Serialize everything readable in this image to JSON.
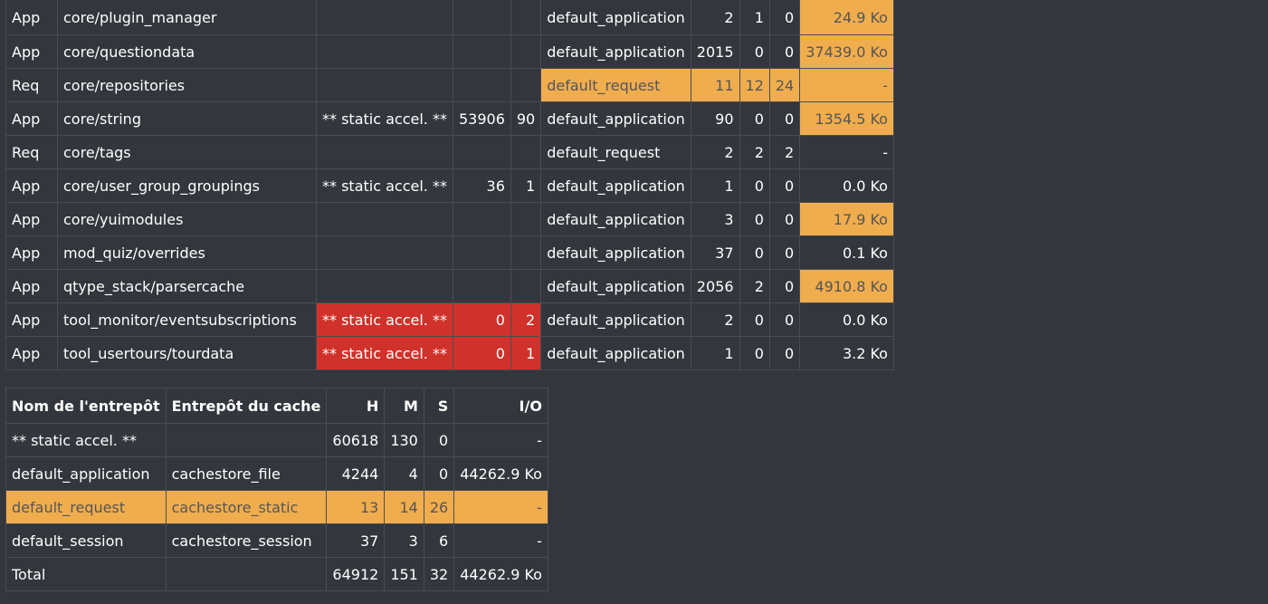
{
  "colors": {
    "background": "#33363c",
    "warning": "#f0ad4e",
    "danger": "#d0312a"
  },
  "definitions_table": {
    "rows": [
      {
        "mode": "App",
        "definition": "core/plugin_manager",
        "static": "",
        "sh": "",
        "sm": "",
        "store": "default_application",
        "h": "2",
        "m": "1",
        "s": "0",
        "io": "24.9 Ko",
        "static_red": false,
        "store_orange": false,
        "io_orange": true
      },
      {
        "mode": "App",
        "definition": "core/questiondata",
        "static": "",
        "sh": "",
        "sm": "",
        "store": "default_application",
        "h": "2015",
        "m": "0",
        "s": "0",
        "io": "37439.0 Ko",
        "static_red": false,
        "store_orange": false,
        "io_orange": true
      },
      {
        "mode": "Req",
        "definition": "core/repositories",
        "static": "",
        "sh": "",
        "sm": "",
        "store": "default_request",
        "h": "11",
        "m": "12",
        "s": "24",
        "io": "-",
        "static_red": false,
        "store_orange": true,
        "io_orange": true
      },
      {
        "mode": "App",
        "definition": "core/string",
        "static": "** static accel. **",
        "sh": "53906",
        "sm": "90",
        "store": "default_application",
        "h": "90",
        "m": "0",
        "s": "0",
        "io": "1354.5 Ko",
        "static_red": false,
        "store_orange": false,
        "io_orange": true
      },
      {
        "mode": "Req",
        "definition": "core/tags",
        "static": "",
        "sh": "",
        "sm": "",
        "store": "default_request",
        "h": "2",
        "m": "2",
        "s": "2",
        "io": "-",
        "static_red": false,
        "store_orange": false,
        "io_orange": false
      },
      {
        "mode": "App",
        "definition": "core/user_group_groupings",
        "static": "** static accel. **",
        "sh": "36",
        "sm": "1",
        "store": "default_application",
        "h": "1",
        "m": "0",
        "s": "0",
        "io": "0.0 Ko",
        "static_red": false,
        "store_orange": false,
        "io_orange": false
      },
      {
        "mode": "App",
        "definition": "core/yuimodules",
        "static": "",
        "sh": "",
        "sm": "",
        "store": "default_application",
        "h": "3",
        "m": "0",
        "s": "0",
        "io": "17.9 Ko",
        "static_red": false,
        "store_orange": false,
        "io_orange": true
      },
      {
        "mode": "App",
        "definition": "mod_quiz/overrides",
        "static": "",
        "sh": "",
        "sm": "",
        "store": "default_application",
        "h": "37",
        "m": "0",
        "s": "0",
        "io": "0.1 Ko",
        "static_red": false,
        "store_orange": false,
        "io_orange": false
      },
      {
        "mode": "App",
        "definition": "qtype_stack/parsercache",
        "static": "",
        "sh": "",
        "sm": "",
        "store": "default_application",
        "h": "2056",
        "m": "2",
        "s": "0",
        "io": "4910.8 Ko",
        "static_red": false,
        "store_orange": false,
        "io_orange": true
      },
      {
        "mode": "App",
        "definition": "tool_monitor/eventsubscriptions",
        "static": "** static accel. **",
        "sh": "0",
        "sm": "2",
        "store": "default_application",
        "h": "2",
        "m": "0",
        "s": "0",
        "io": "0.0 Ko",
        "static_red": true,
        "store_orange": false,
        "io_orange": false
      },
      {
        "mode": "App",
        "definition": "tool_usertours/tourdata",
        "static": "** static accel. **",
        "sh": "0",
        "sm": "1",
        "store": "default_application",
        "h": "1",
        "m": "0",
        "s": "0",
        "io": "3.2 Ko",
        "static_red": true,
        "store_orange": false,
        "io_orange": false
      }
    ]
  },
  "stores_table": {
    "headers": {
      "name": "Nom de l'entrepôt",
      "plugin": "Entrepôt du cache",
      "h": "H",
      "m": "M",
      "s": "S",
      "io": "I/O"
    },
    "rows": [
      {
        "name": "** static accel. **",
        "plugin": "",
        "h": "60618",
        "m": "130",
        "s": "0",
        "io": "-",
        "highlight": false
      },
      {
        "name": "default_application",
        "plugin": "cachestore_file",
        "h": "4244",
        "m": "4",
        "s": "0",
        "io": "44262.9 Ko",
        "highlight": false
      },
      {
        "name": "default_request",
        "plugin": "cachestore_static",
        "h": "13",
        "m": "14",
        "s": "26",
        "io": "-",
        "highlight": true
      },
      {
        "name": "default_session",
        "plugin": "cachestore_session",
        "h": "37",
        "m": "3",
        "s": "6",
        "io": "-",
        "highlight": false
      },
      {
        "name": "Total",
        "plugin": "",
        "h": "64912",
        "m": "151",
        "s": "32",
        "io": "44262.9 Ko",
        "highlight": false
      }
    ]
  }
}
